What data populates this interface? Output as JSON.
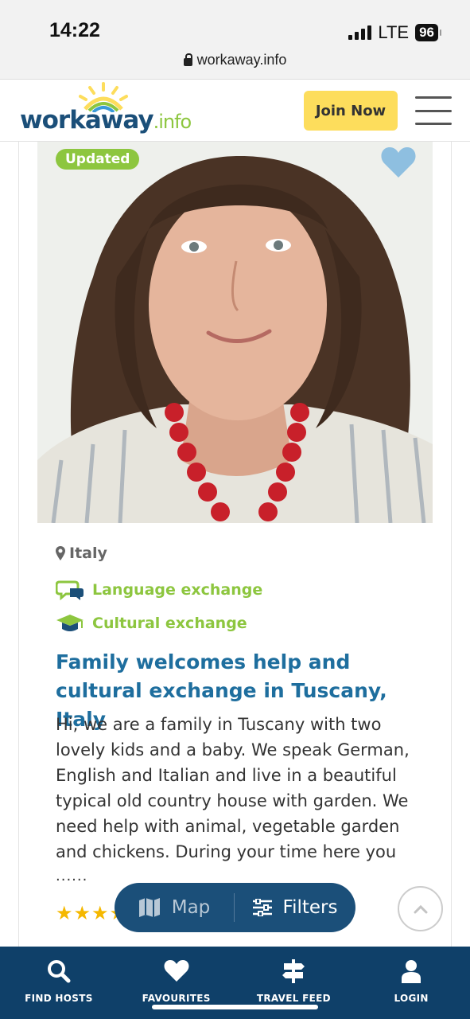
{
  "status_bar": {
    "time": "14:22",
    "network": "LTE",
    "battery": "96",
    "url": "workaway.info"
  },
  "header": {
    "logo_main": "workaway",
    "logo_suffix": ".info",
    "join_label": "Join Now",
    "menu_icon": "hamburger-menu-icon"
  },
  "listing": {
    "badge": "Updated",
    "favourite_icon": "heart-icon",
    "location": "Italy",
    "tags": [
      {
        "label": "Language exchange",
        "icon": "chat-bubbles-icon"
      },
      {
        "label": "Cultural exchange",
        "icon": "graduation-cap-icon"
      }
    ],
    "title": "Family welcomes help and cultural exchange in Tuscany, Italy",
    "description": "Hi, we are a family in Tuscany with two lovely kids and a baby. We speak German, English and Italian and live in a beautiful typical old country house with garden. We need help with animal, vegetable garden and chickens. During your time here you",
    "ellipsis": "......",
    "rating_stars": 5
  },
  "floating": {
    "map_label": "Map",
    "filters_label": "Filters"
  },
  "bottom_nav": {
    "items": [
      {
        "label": "FIND HOSTS",
        "icon": "search-icon"
      },
      {
        "label": "FAVOURITES",
        "icon": "heart-icon"
      },
      {
        "label": "TRAVEL FEED",
        "icon": "signpost-icon"
      },
      {
        "label": "LOGIN",
        "icon": "user-icon"
      }
    ]
  },
  "colors": {
    "brand_blue": "#1b4f79",
    "brand_green": "#8dc63f",
    "join_yellow": "#fddd5c",
    "nav_bg": "#0f4069",
    "title_blue": "#1e6e9e",
    "star": "#f5b800"
  }
}
